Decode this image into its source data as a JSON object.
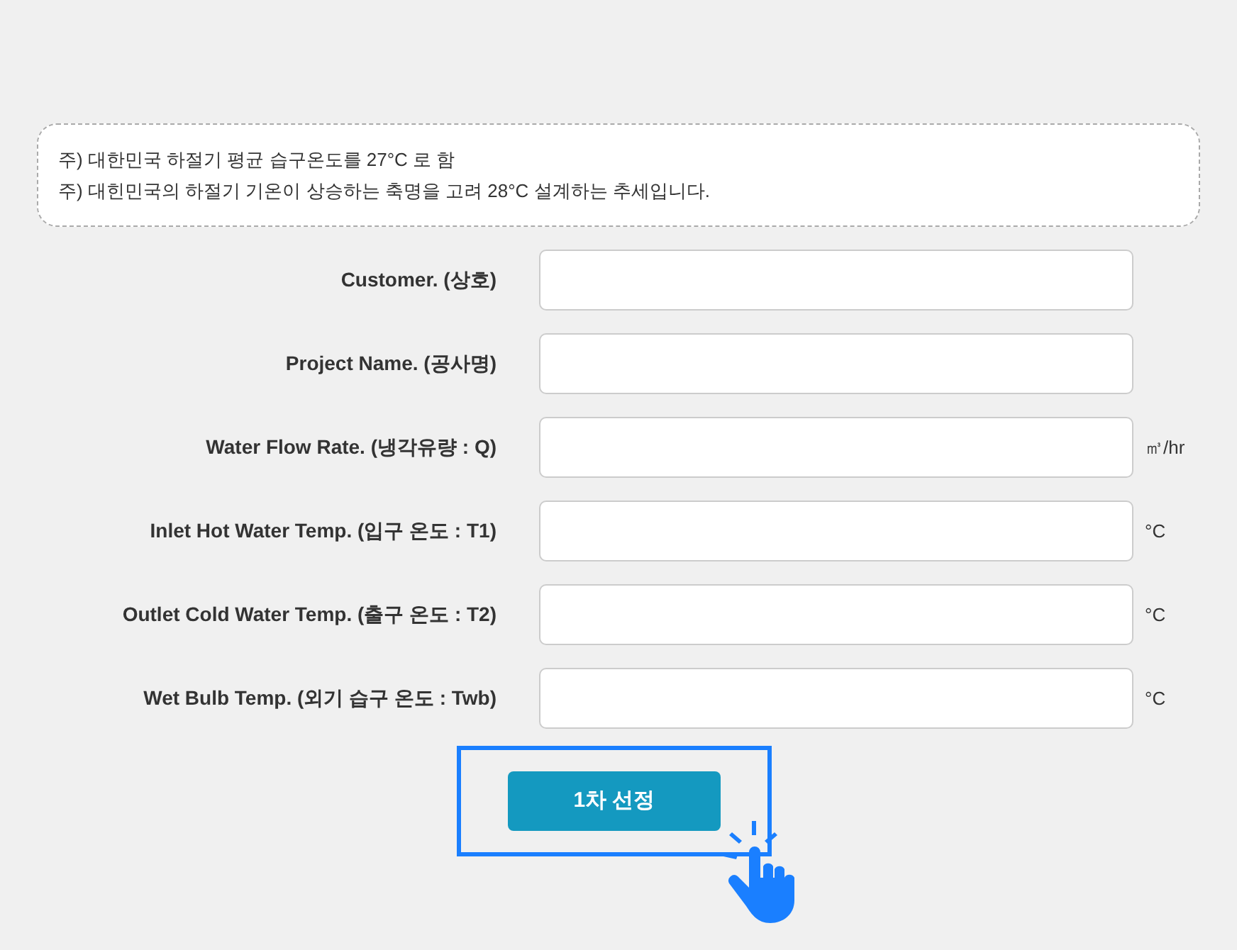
{
  "notes": [
    "주) 대한민국 하절기 평균 습구온도를 27°C 로 함",
    "주) 대힌민국의 하절기 기온이 상승하는 축명을 고려 28°C 설계하는 추세입니다."
  ],
  "fields": [
    {
      "label": "Customer. (상호)"
    },
    {
      "label": "Project Name. (공사명)"
    },
    {
      "label": "Water Flow Rate. (냉각유량 : Q)",
      "unit": "㎥/hr"
    },
    {
      "label": "Inlet Hot Water Temp. (입구 온도 : T1)",
      "unit": "°C"
    },
    {
      "label": "Outlet Cold Water Temp. (출구 온도 : T2)",
      "unit": "°C"
    },
    {
      "label": "Wet Bulb Temp. (외기 습구 온도 : Twb)",
      "unit": "°C"
    }
  ],
  "submit": {
    "label": "1차 선정",
    "highlighted": true
  }
}
